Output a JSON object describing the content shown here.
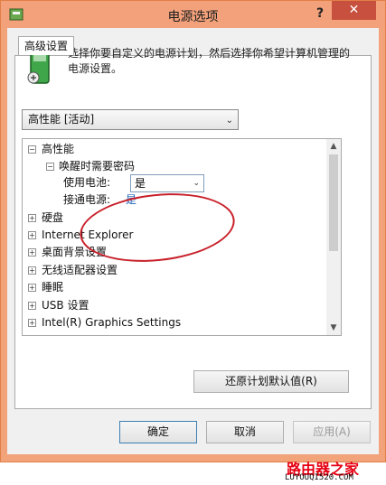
{
  "window": {
    "title": "电源选项",
    "help": "?",
    "close": "✕"
  },
  "tab": {
    "label": "高级设置"
  },
  "description": "选择你要自定义的电源计划，然后选择你希望计算机管理的电源设置。",
  "plan_select": {
    "value": "高性能 [活动]"
  },
  "tree": {
    "root": "高性能",
    "wake_password": "唤醒时需要密码",
    "on_battery_label": "使用电池:",
    "on_battery_value": "是",
    "plugged_in_label": "接通电源:",
    "plugged_in_value": "是",
    "items": [
      "硬盘",
      "Internet Explorer",
      "桌面背景设置",
      "无线适配器设置",
      "睡眠",
      "USB 设置",
      "Intel(R) Graphics Settings"
    ]
  },
  "buttons": {
    "restore": "还原计划默认值(R)",
    "ok": "确定",
    "cancel": "取消",
    "apply": "应用(A)"
  },
  "watermark": {
    "title": "路由器之家",
    "url": "LUYOUQI520.COM"
  },
  "colors": {
    "titlebar": "#f2a17b",
    "close": "#c7503e",
    "link": "#1a5fb4",
    "annotation": "#c8202a"
  }
}
